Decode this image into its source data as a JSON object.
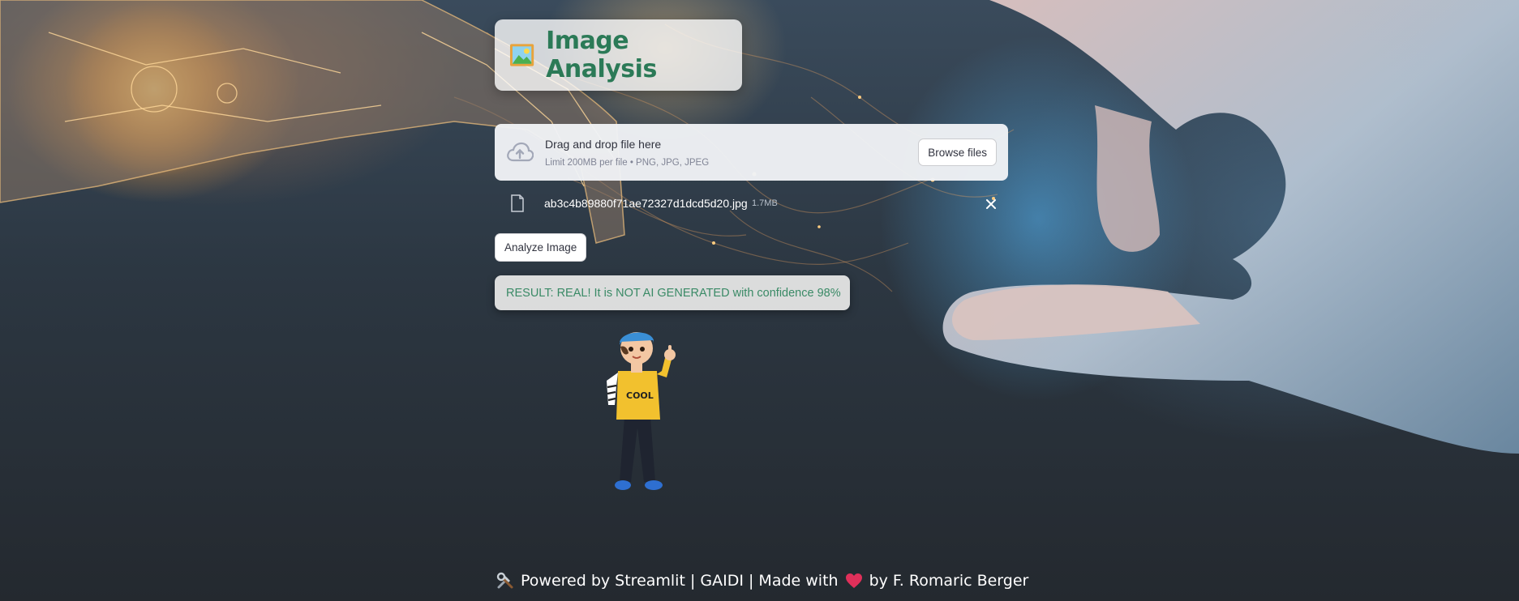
{
  "title": {
    "text": "Image Analysis",
    "icon": "framed-picture-icon",
    "color": "#2b7a57"
  },
  "uploader": {
    "icon": "cloud-upload-icon",
    "drop_text": "Drag and drop file here",
    "limit_text": "Limit 200MB per file • PNG, JPG, JPEG",
    "browse_label": "Browse files"
  },
  "uploaded_file": {
    "icon": "file-icon",
    "name": "ab3c4b89880f71ae72327d1dcd5d20.jpg",
    "size": "1.7MB",
    "remove_icon": "close-icon"
  },
  "analyze_button": {
    "label": "Analyze Image"
  },
  "result": {
    "text": "RESULT: REAL! It is NOT AI GENERATED with confidence 98%",
    "color": "#3a8a66"
  },
  "character": {
    "icon": "cool-kid-thumbs-up-illustration",
    "shirt_text": "COOL"
  },
  "footer": {
    "icon": "hammer-and-wrench-icon",
    "part1": "Powered by Streamlit | GAIDI | Made with",
    "heart_icon": "red-heart-icon",
    "part2": "by F. Romaric Berger"
  }
}
